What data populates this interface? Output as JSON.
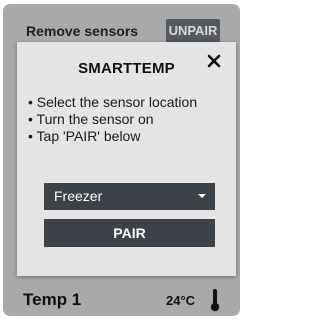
{
  "background": {
    "header_label": "Remove sensors",
    "unpair_label": "UNPAIR",
    "sensor_name": "Temp 1",
    "temperature": "24°C",
    "sensor_icon": "thermometer-icon"
  },
  "modal": {
    "title": "SMARTTEMP",
    "close_icon": "close-icon",
    "instructions": [
      "• Select the sensor location",
      "• Turn the sensor on",
      "• Tap 'PAIR' below"
    ],
    "location_select": {
      "selected": "Freezer",
      "caret_icon": "caret-down-icon"
    },
    "pair_label": "PAIR"
  },
  "colors": {
    "panel_bg": "#a9a9a9",
    "modal_bg": "#e4e4e4",
    "control_bg": "#3d4148",
    "unpair_bg": "#555a60"
  }
}
